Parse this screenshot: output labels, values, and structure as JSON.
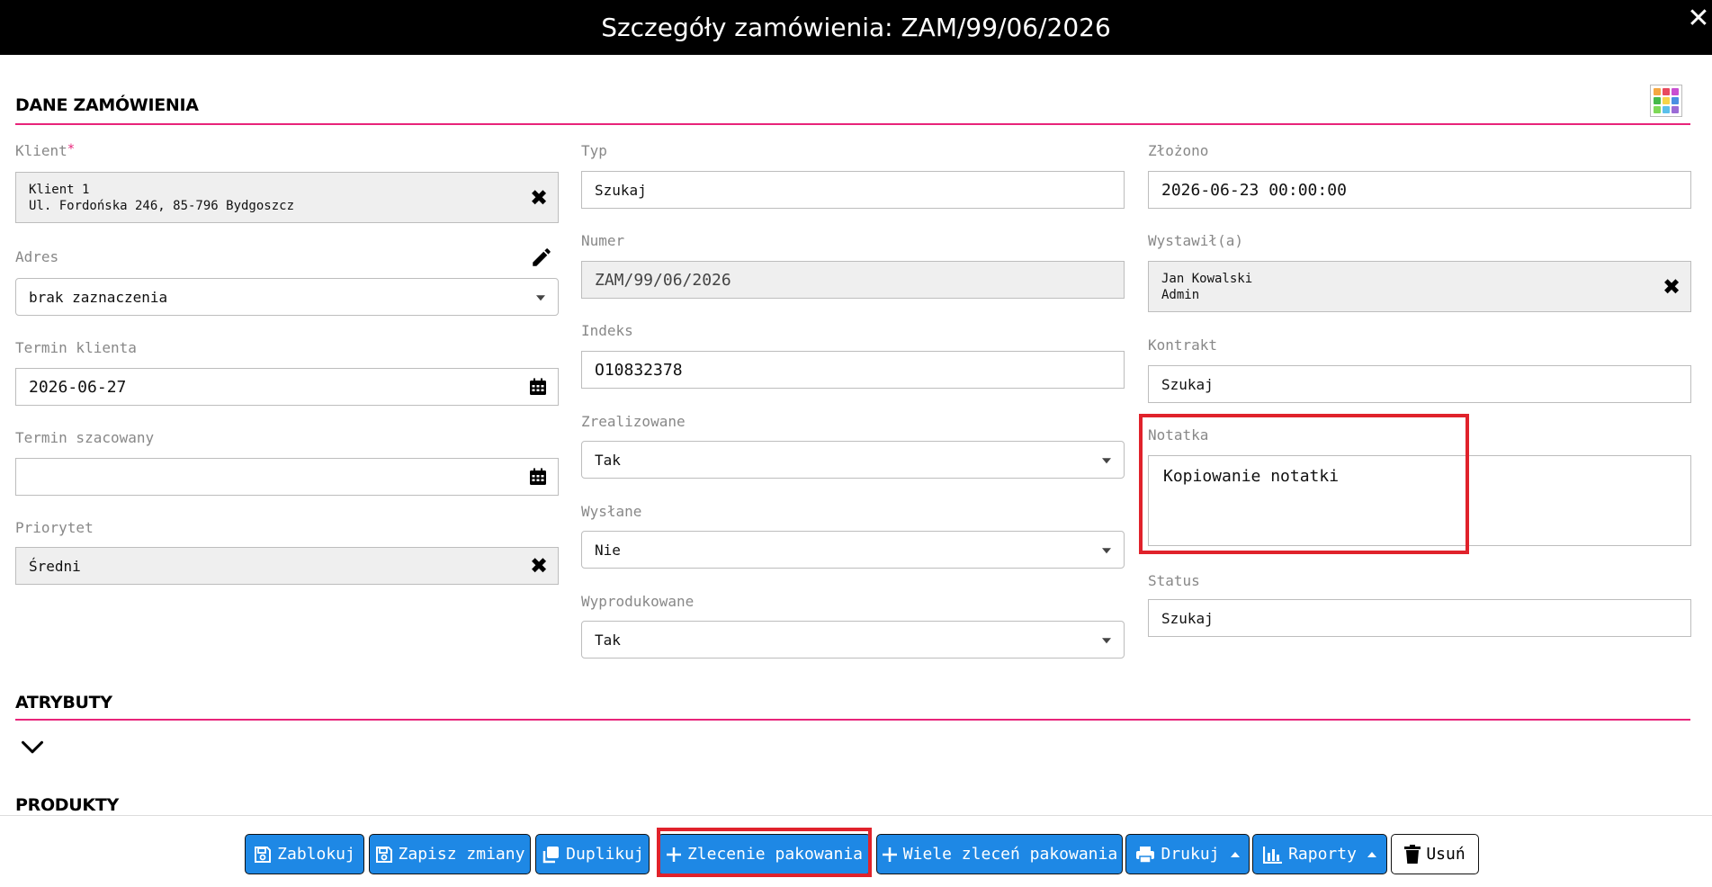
{
  "window": {
    "title": "Szczegóły zamówienia: ZAM/99/06/2026",
    "close_symbol": "✕"
  },
  "sections": {
    "order": "DANE ZAMÓWIENIA",
    "attributes": "ATRYBUTY",
    "products": "PRODUKTY"
  },
  "left": {
    "client": {
      "label": "Klient",
      "required_mark": "*",
      "line1": "Klient 1",
      "line2": "Ul. Fordońska 246, 85-796 Bydgoszcz"
    },
    "address": {
      "label": "Adres",
      "value": "brak zaznaczenia"
    },
    "client_deadline": {
      "label": "Termin klienta",
      "value": "2026-06-27"
    },
    "estimated_deadline": {
      "label": "Termin szacowany",
      "value": ""
    },
    "priority": {
      "label": "Priorytet",
      "value": "Średni"
    }
  },
  "middle": {
    "type": {
      "label": "Typ",
      "value": "Szukaj"
    },
    "number": {
      "label": "Numer",
      "value": "ZAM/99/06/2026"
    },
    "index": {
      "label": "Indeks",
      "value": "O10832378"
    },
    "realized": {
      "label": "Zrealizowane",
      "value": "Tak"
    },
    "sent": {
      "label": "Wysłane",
      "value": "Nie"
    },
    "produced": {
      "label": "Wyprodukowane",
      "value": "Tak"
    }
  },
  "right": {
    "placed": {
      "label": "Złożono",
      "value": "2026-06-23 00:00:00"
    },
    "issued_by": {
      "label": "Wystawił(a)",
      "line1": "Jan Kowalski",
      "line2": "Admin"
    },
    "contract": {
      "label": "Kontrakt",
      "value": "Szukaj"
    },
    "note": {
      "label": "Notatka",
      "value": "Kopiowanie notatki"
    },
    "status": {
      "label": "Status",
      "value": "Szukaj"
    }
  },
  "toolbar": {
    "block": "Zablokuj",
    "save": "Zapisz zmiany",
    "duplicate": "Duplikuj",
    "packing_order": "Zlecenie pakowania",
    "multi_packing": "Wiele zleceń pakowania",
    "print": "Drukuj",
    "reports": "Raporty",
    "delete": "Usuń"
  },
  "colors": {
    "accent_line": "#e8247a",
    "button_blue": "#1e88e5",
    "highlight_red": "#e0222b"
  },
  "icons": [
    "close-icon",
    "grid-icon",
    "remove-icon",
    "pencil-icon",
    "calendar-icon",
    "chevron-down-icon",
    "save-icon",
    "duplicate-icon",
    "plus-icon",
    "print-icon",
    "chart-icon",
    "trash-icon"
  ]
}
